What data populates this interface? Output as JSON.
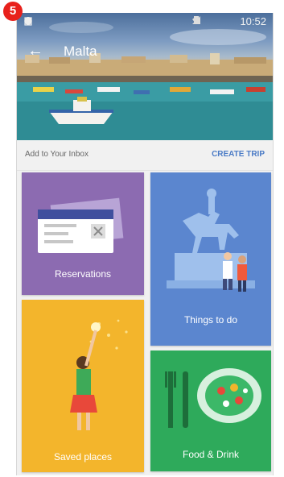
{
  "step_badge": "5",
  "status_bar": {
    "time": "10:52"
  },
  "app_bar": {
    "title": "Malta"
  },
  "inbox": {
    "text": "Add to Your Inbox",
    "action": "CREATE TRIP"
  },
  "cards": [
    {
      "label": "Reservations",
      "color": "#8c6bb1"
    },
    {
      "label": "Things to do",
      "color": "#5b86cf"
    },
    {
      "label": "Saved places",
      "color": "#f3b52c"
    },
    {
      "label": "Food & Drink",
      "color": "#2eaa5b"
    }
  ]
}
